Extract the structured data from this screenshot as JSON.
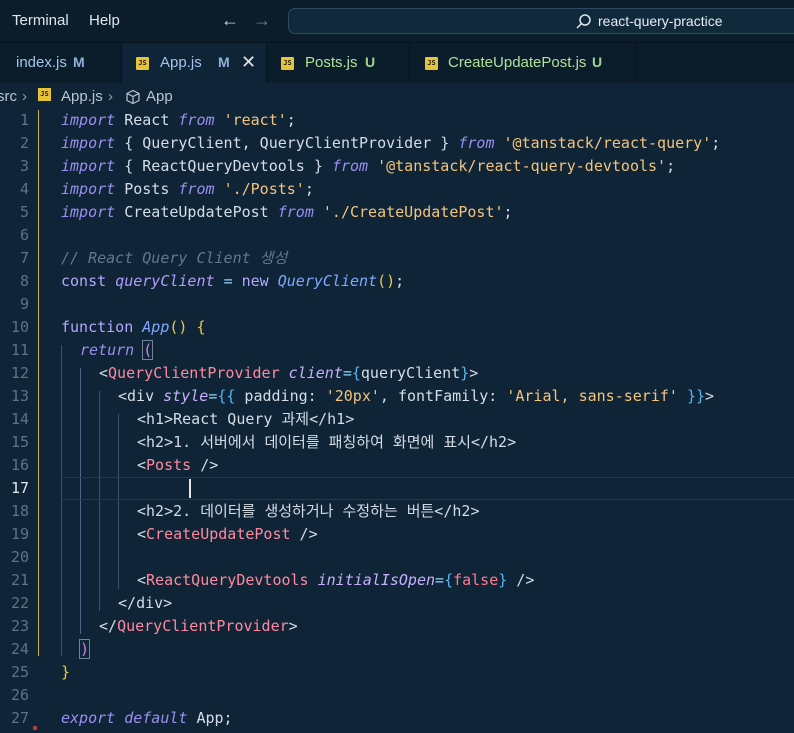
{
  "titlebar": {
    "menu": [
      "Terminal",
      "Help"
    ],
    "back_icon": "arrow-left-icon",
    "forward_icon": "arrow-right-icon",
    "search_text": "react-query-practice"
  },
  "tabs": [
    {
      "label": "index.js",
      "status": "M",
      "kind": "modified"
    },
    {
      "label": "App.js",
      "status": "M",
      "kind": "modified",
      "active": true
    },
    {
      "label": "Posts.js",
      "status": "U",
      "kind": "untracked"
    },
    {
      "label": "CreateUpdatePost.js",
      "status": "U",
      "kind": "untracked"
    }
  ],
  "tab_badge": "JS",
  "breadcrumb": {
    "folder": "src",
    "file": "App.js",
    "symbol": "App"
  },
  "editor": {
    "current_line": 17,
    "lines": [
      {
        "n": "1"
      },
      {
        "n": "2"
      },
      {
        "n": "3"
      },
      {
        "n": "4"
      },
      {
        "n": "5"
      },
      {
        "n": "6"
      },
      {
        "n": "7"
      },
      {
        "n": "8"
      },
      {
        "n": "9"
      },
      {
        "n": "10"
      },
      {
        "n": "11"
      },
      {
        "n": "12"
      },
      {
        "n": "13"
      },
      {
        "n": "14"
      },
      {
        "n": "15"
      },
      {
        "n": "16"
      },
      {
        "n": "17"
      },
      {
        "n": "18"
      },
      {
        "n": "19"
      },
      {
        "n": "20"
      },
      {
        "n": "21"
      },
      {
        "n": "22"
      },
      {
        "n": "23"
      },
      {
        "n": "24"
      },
      {
        "n": "25"
      },
      {
        "n": "26"
      },
      {
        "n": "27"
      }
    ],
    "tokens": {
      "l1": [
        "import",
        " React ",
        "from",
        " ",
        "'react'",
        ";"
      ],
      "l2": [
        "import",
        " { QueryClient, QueryClientProvider } ",
        "from",
        " ",
        "'@tanstack/react-query'",
        ";"
      ],
      "l3": [
        "import",
        " { ReactQueryDevtools } ",
        "from",
        " ",
        "'@tanstack/react-query-devtools'",
        ";"
      ],
      "l4": [
        "import",
        " Posts ",
        "from",
        " ",
        "'./Posts'",
        ";"
      ],
      "l5": [
        "import",
        " CreateUpdatePost ",
        "from",
        " ",
        "'./CreateUpdatePost'",
        ";"
      ],
      "l7": [
        "// React Query Client 생성"
      ],
      "l8": [
        "const",
        " ",
        "queryClient",
        " ",
        "=",
        " ",
        "new",
        " ",
        "QueryClient",
        "()",
        ";"
      ],
      "l10": [
        "function",
        " ",
        "App",
        "() ",
        "{"
      ],
      "l11": [
        "return",
        " ",
        "("
      ],
      "l12": [
        "<",
        "QueryClientProvider",
        " ",
        "client",
        "=",
        "{",
        "queryClient",
        "}",
        ">"
      ],
      "l13": [
        "<",
        "div",
        " ",
        "style",
        "=",
        "{{",
        " padding: ",
        "'20px'",
        ", fontFamily: ",
        "'Arial, sans-serif'",
        " ",
        "}}",
        ">"
      ],
      "l14": [
        "<",
        "h1",
        ">React Query 과제</",
        "h1",
        ">"
      ],
      "l15": [
        "<",
        "h2",
        ">1. 서버에서 데이터를 패칭하여 화면에 표시</",
        "h2",
        ">"
      ],
      "l16": [
        "<",
        "Posts",
        " />"
      ],
      "l18": [
        "<",
        "h2",
        ">2. 데이터를 생성하거나 수정하는 버튼</",
        "h2",
        ">"
      ],
      "l19": [
        "<",
        "CreateUpdatePost",
        " />"
      ],
      "l21": [
        "<",
        "ReactQueryDevtools",
        " ",
        "initialIsOpen",
        "=",
        "{",
        "false",
        "}",
        " />"
      ],
      "l22": [
        "</",
        "div",
        ">"
      ],
      "l23": [
        "</",
        "QueryClientProvider",
        ">"
      ],
      "l24": [
        ")"
      ],
      "l25": [
        "}"
      ],
      "l27": [
        "export",
        " ",
        "default",
        " App;"
      ]
    }
  }
}
